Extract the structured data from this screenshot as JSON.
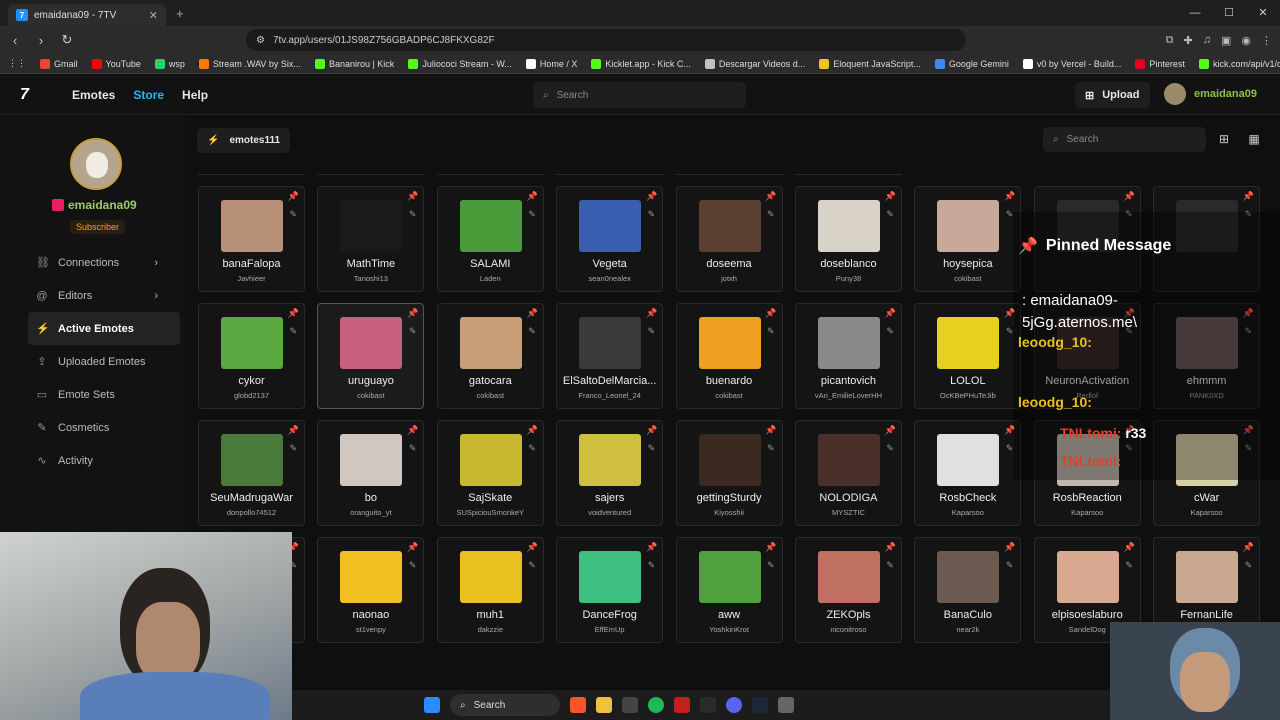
{
  "browser": {
    "tab_title": "emaidana09 - 7TV",
    "url": "7tv.app/users/01JS98Z756GBADP6CJ8FKXG82F",
    "bookmarks": [
      "Gmail",
      "YouTube",
      "wsp",
      "Stream .WAV by Six...",
      "Bananirou | Kick",
      "Juliococi Stream - W...",
      "Home / X",
      "Kicklet.app - Kick C...",
      "Descargar Videos d...",
      "Eloquent JavaScript...",
      "Google Gemini",
      "v0 by Vercel - Build...",
      "Pinterest",
      "kick.com/api/v1/cha..."
    ]
  },
  "site": {
    "nav": [
      "Emotes",
      "Store",
      "Help"
    ],
    "search_placeholder": "Search",
    "upload_label": "Upload",
    "username": "emaidana09"
  },
  "sidebar": {
    "username": "emaidana09",
    "badge": "Subscriber",
    "items": [
      {
        "label": "Connections",
        "icon": "link-icon",
        "chevron": true
      },
      {
        "label": "Editors",
        "icon": "at-icon",
        "chevron": true
      },
      {
        "label": "Active Emotes",
        "icon": "bolt-icon",
        "active": true
      },
      {
        "label": "Uploaded Emotes",
        "icon": "upload-icon"
      },
      {
        "label": "Emote Sets",
        "icon": "folder-icon"
      },
      {
        "label": "Cosmetics",
        "icon": "brush-icon"
      },
      {
        "label": "Activity",
        "icon": "activity-icon"
      }
    ]
  },
  "main": {
    "set_name": "emotes111",
    "search_placeholder": "Search"
  },
  "emotes": [
    {
      "name": "banaFalopa",
      "owner": "Javhieer",
      "color": "#b89078"
    },
    {
      "name": "MathTime",
      "owner": "Tanoshi13",
      "color": "#1a1a1a"
    },
    {
      "name": "SALAMI",
      "owner": "Laden",
      "color": "#4a9a3a"
    },
    {
      "name": "Vegeta",
      "owner": "sean0nealex",
      "color": "#3a5fb0"
    },
    {
      "name": "doseema",
      "owner": "jotxh",
      "color": "#5a4030"
    },
    {
      "name": "doseblanco",
      "owner": "Puny38",
      "color": "#d8d2c8"
    },
    {
      "name": "hoysepica",
      "owner": "cokibast",
      "color": "#c8a898"
    },
    {
      "name": "",
      "owner": "",
      "color": "#2a2a2a"
    },
    {
      "name": "",
      "owner": "",
      "color": "#2a2a2a"
    },
    {
      "name": "cykor",
      "owner": "globd2137",
      "color": "#5aa840"
    },
    {
      "name": "uruguayo",
      "owner": "cokibast",
      "color": "#c86080"
    },
    {
      "name": "gatocara",
      "owner": "cokibast",
      "color": "#c8a078"
    },
    {
      "name": "ElSaltoDelMarcia...",
      "owner": "Franco_Leonel_24",
      "color": "#3a3a3a"
    },
    {
      "name": "buenardo",
      "owner": "cokibast",
      "color": "#f0a020"
    },
    {
      "name": "picantovich",
      "owner": "vAri_EmilieLoverHH",
      "color": "#8a8a8a"
    },
    {
      "name": "LOLOL",
      "owner": "OcKBePHuTeJib",
      "color": "#e8d020"
    },
    {
      "name": "NeuronActivation",
      "owner": "Redlof",
      "color": "#3a2a2a"
    },
    {
      "name": "ehmmm",
      "owner": "PANK0XD",
      "color": "#6a5a58"
    },
    {
      "name": "SeuMadrugaWar",
      "owner": "donpollo74512",
      "color": "#4a7a3a"
    },
    {
      "name": "bo",
      "owner": "oranguito_yt",
      "color": "#d0c8c0"
    },
    {
      "name": "SajSkate",
      "owner": "SUSpiciouSmonkeY",
      "color": "#c8b830"
    },
    {
      "name": "sajers",
      "owner": "voidventured",
      "color": "#d0c040"
    },
    {
      "name": "gettingSturdy",
      "owner": "Kiyosshii",
      "color": "#3a2a20"
    },
    {
      "name": "NOLODIGA",
      "owner": "MYSZTIC",
      "color": "#4a3028"
    },
    {
      "name": "RosbCheck",
      "owner": "Kaparsoo",
      "color": "#e0e0e0"
    },
    {
      "name": "RosbReaction",
      "owner": "Kaparsoo",
      "color": "#c0b8b0"
    },
    {
      "name": "cWar",
      "owner": "Kaparsoo",
      "color": "#d8d0a8"
    },
    {
      "name": "",
      "owner": "",
      "color": "#141414"
    },
    {
      "name": "naonao",
      "owner": "st1venpy",
      "color": "#f0c020"
    },
    {
      "name": "muh1",
      "owner": "dakzzie",
      "color": "#e8c020"
    },
    {
      "name": "DanceFrog",
      "owner": "EffEmUp",
      "color": "#40c080"
    },
    {
      "name": "aww",
      "owner": "YoshkinKrot",
      "color": "#50a040"
    },
    {
      "name": "ZEKOpls",
      "owner": "niconitroso",
      "color": "#c07060"
    },
    {
      "name": "BanaCulo",
      "owner": "near2k",
      "color": "#6a5a50"
    },
    {
      "name": "elpisoeslaburo",
      "owner": "SandelDog",
      "color": "#d8a890"
    },
    {
      "name": "FernanLife",
      "owner": "",
      "color": "#c8a890"
    }
  ],
  "chat": {
    "pinned_title": "Pinned Message",
    "message": ": emaidana09-\n5jGg.aternos.me\\",
    "lines": [
      {
        "user": "leoodg_10:",
        "color": "#e8c020"
      },
      {
        "user": "leoodg_10:",
        "color": "#e8c020"
      },
      {
        "user": "TNLtomi:",
        "text": " r33",
        "color": "#e0402a"
      },
      {
        "user": "TNLtomi:",
        "color": "#e0402a"
      }
    ]
  },
  "taskbar": {
    "search_label": "Search"
  }
}
